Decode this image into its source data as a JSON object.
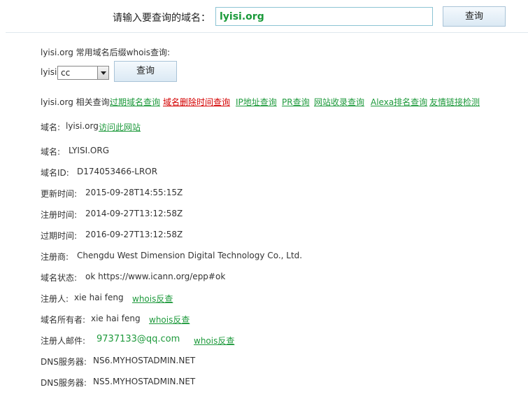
{
  "search": {
    "prompt": "请输入要查询的域名：",
    "value": "lyisi.org",
    "button": "查询"
  },
  "suffix": {
    "heading": "lyisi.org 常用域名后缀whois查询:",
    "prefix": "lyisi.",
    "selected": "cc",
    "button": "查询"
  },
  "related": {
    "label": "lyisi.org 相关查询:",
    "links": [
      "过期域名查询",
      "域名删除时间查询",
      "IP地址查询",
      "PR查询",
      "网站收录查询",
      "Alexa排名查询",
      "友情链接检测"
    ]
  },
  "site": {
    "label": "域名:",
    "domain": "lyisi.org",
    "visit": "访问此网站"
  },
  "whois": {
    "domain_name": {
      "label": "域名:",
      "value": "LYISI.ORG"
    },
    "domain_id": {
      "label": "域名ID:",
      "value": "D174053466-LROR"
    },
    "updated": {
      "label": "更新时间:",
      "value": "2015-09-28T14:55:15Z"
    },
    "created": {
      "label": "注册时间:",
      "value": "2014-09-27T13:12:58Z"
    },
    "expires": {
      "label": "过期时间:",
      "value": "2016-09-27T13:12:58Z"
    },
    "registrar": {
      "label": "注册商:",
      "value": "Chengdu West Dimension Digital Technology Co., Ltd."
    },
    "status": {
      "label": "域名状态:",
      "value": "ok https://www.icann.org/epp#ok"
    },
    "registrant": {
      "label": "注册人:",
      "value": "xie hai feng",
      "link": "whois反查"
    },
    "owner": {
      "label": "域名所有者:",
      "value": "xie hai feng",
      "link": "whois反查"
    },
    "email": {
      "label": "注册人邮件:",
      "value": "9737133@qq.com",
      "link": "whois反查"
    },
    "dns1": {
      "label": "DNS服务器:",
      "value": "NS6.MYHOSTADMIN.NET"
    },
    "dns2": {
      "label": "DNS服务器:",
      "value": "NS5.MYHOSTADMIN.NET"
    }
  },
  "colors": {
    "link": "#1e9a3c",
    "highlight_link": "#d40000",
    "input_border": "#8cc4d4"
  }
}
